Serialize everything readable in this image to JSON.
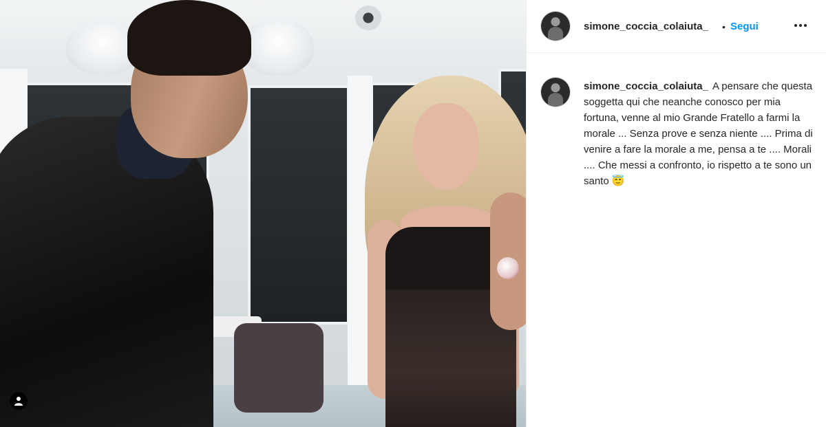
{
  "post": {
    "username": "simone_coccia_colaiuta_",
    "separator": "•",
    "follow_label": "Segui",
    "more_icon": "more-horizontal-icon",
    "caption": {
      "username": "simone_coccia_colaiuta_",
      "text": "A pensare che questa soggetta qui che neanche conosco per mia fortuna, venne al mio Grande Fratello a farmi la morale ... Senza prove e senza niente .... Prima di venire a fare la morale a me, pensa a te .... Morali .... Che messi a confronto, io rispetto a te sono un santo 😇"
    },
    "photo": {
      "tag_icon": "user-tag-icon"
    }
  },
  "colors": {
    "link_blue": "#0095f6",
    "text_primary": "#262626",
    "border": "#efefef"
  }
}
